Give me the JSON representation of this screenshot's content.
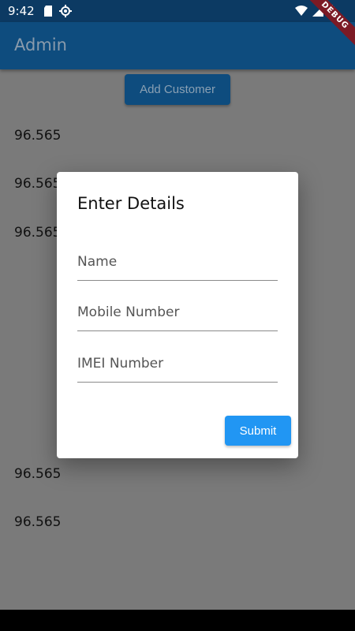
{
  "status_bar": {
    "time": "9:42",
    "icons_left": [
      "sd-card-icon",
      "settings-gear-icon"
    ],
    "icons_right": [
      "wifi-icon",
      "signal-icon",
      "battery-icon"
    ]
  },
  "debug_banner": "DEBUG",
  "app_bar": {
    "title": "Admin"
  },
  "add_customer_label": "Add Customer",
  "list": {
    "items": [
      "96.565",
      "96.565",
      "96.565",
      "96.565",
      "96.565"
    ]
  },
  "dialog": {
    "title": "Enter Details",
    "fields": [
      {
        "label": "Name"
      },
      {
        "label": "Mobile Number"
      },
      {
        "label": "IMEI Number"
      }
    ],
    "submit_label": "Submit"
  },
  "colors": {
    "app_bar": "#0e4c7e",
    "status_bar": "#0c3a63",
    "accent": "#2196f3",
    "scrim": "#7a7a7a",
    "debug": "#7c1a25"
  }
}
